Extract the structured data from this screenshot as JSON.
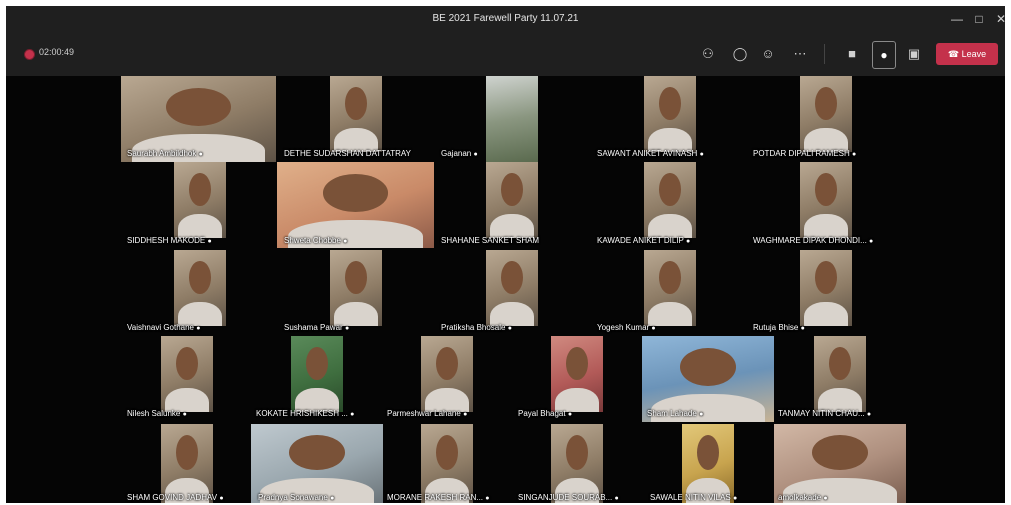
{
  "window": {
    "title": "BE 2021 Farewell Party 11.07.21"
  },
  "toolbar": {
    "timer": "02:00:49",
    "leave_label": "Leave",
    "icons": [
      "participants-icon",
      "chat-icon",
      "reactions-icon",
      "more-icon",
      "camera-off-icon",
      "mic-icon",
      "share-icon"
    ]
  },
  "colors": {
    "leave": "#c4314b",
    "toolbar_bg": "#1f1f1f",
    "stage_bg": "#050505"
  },
  "participants": [
    {
      "name": "Saurabh Ambildhok"
    },
    {
      "name": "DETHE SUDARSHAN DATTATRAY"
    },
    {
      "name": "Gajanan"
    },
    {
      "name": "SAWANT ANIKET AVINASH"
    },
    {
      "name": "POTDAR DIPALI RAMESH"
    },
    {
      "name": "SIDDHESH MAKODE"
    },
    {
      "name": "Shweta Chobbe"
    },
    {
      "name": "SHAHANE SANKET SHAM"
    },
    {
      "name": "KAWADE ANIKET DILIP"
    },
    {
      "name": "WAGHMARE DIPAK DHONDI..."
    },
    {
      "name": "Vaishnavi Gothane"
    },
    {
      "name": "Sushama Pawar"
    },
    {
      "name": "Pratiksha Bhosale"
    },
    {
      "name": "Yogesh Kumar"
    },
    {
      "name": "Rutuja Bhise"
    },
    {
      "name": "Nilesh Salunke"
    },
    {
      "name": "KOKATE HRISHIKESH ..."
    },
    {
      "name": "Parmeshwar Lahane"
    },
    {
      "name": "Payal Bhagat"
    },
    {
      "name": "Sham Lahade"
    },
    {
      "name": "TANMAY NITIN CHAU..."
    },
    {
      "name": "SHAM GOVIND JADHAV"
    },
    {
      "name": "Pradnya Sonawane"
    },
    {
      "name": "MORANE RAKESH RAN..."
    },
    {
      "name": "SINGANJUDE SOURAB..."
    },
    {
      "name": "SAWALE NITIN VILAS"
    },
    {
      "name": "amolkakade"
    }
  ]
}
